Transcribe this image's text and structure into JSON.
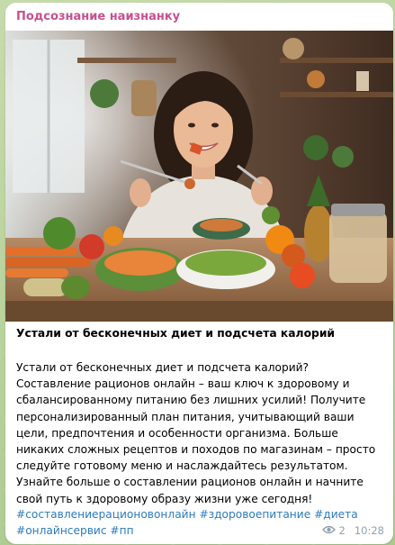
{
  "channel": {
    "name": "Подсознание наизнанку"
  },
  "post": {
    "title": "Устали от бесконечных диет и подсчета калорий",
    "body": "Устали от бесконечных диет и подсчета калорий?  Составление рационов онлайн – ваш ключ к здоровому и сбалансированному питанию без лишних усилий!  Получите персонализированный план питания, учитывающий ваши цели, предпочтения и особенности организма.  Больше никаких сложных рецептов и походов по магазинам – просто следуйте готовому меню и наслаждайтесь результатом. Узнайте больше о составлении рационов онлайн и начните свой путь к здоровому образу жизни уже сегодня!",
    "hashtags": [
      "#составлениерационовонлайн",
      "#здоровоепитание",
      "#диета",
      "#онлайнсервис",
      "#пп"
    ],
    "image_icon": "photo-woman-eating-vegetables"
  },
  "meta": {
    "views": "2",
    "time": "10:28",
    "views_icon": "eye-icon"
  },
  "colors": {
    "channel": "#c9508f",
    "link": "#2b7bbf",
    "meta": "#8fa1ad"
  }
}
